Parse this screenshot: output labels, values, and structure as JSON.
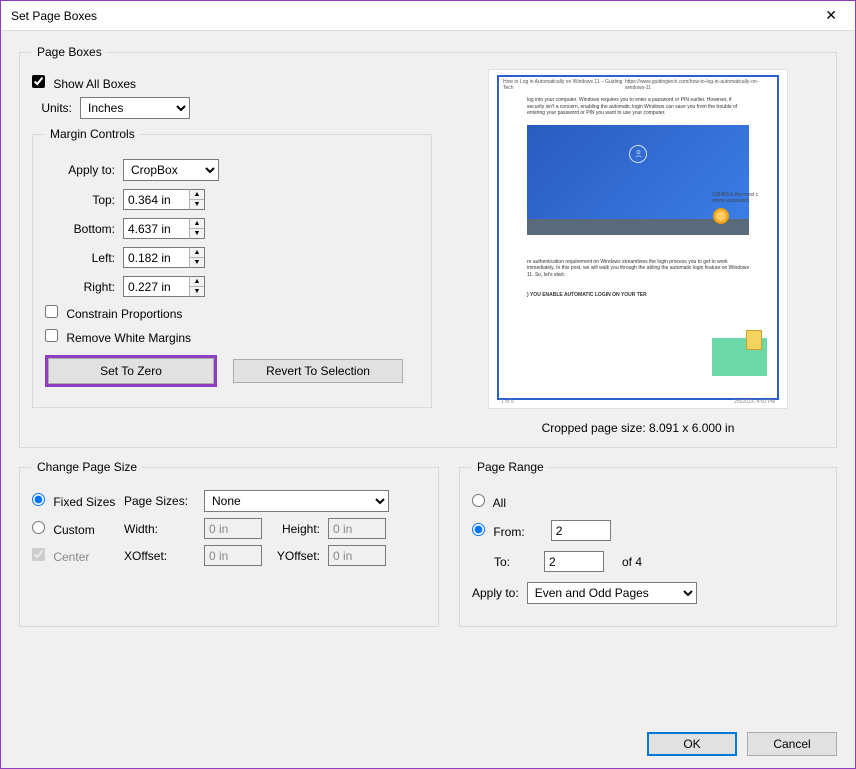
{
  "window": {
    "title": "Set Page Boxes"
  },
  "pageBoxes": {
    "legend": "Page Boxes",
    "showAll": {
      "label": "Show All Boxes",
      "checked": true
    },
    "units": {
      "label": "Units:",
      "value": "Inches"
    },
    "margin": {
      "legend": "Margin Controls",
      "applyTo": {
        "label": "Apply to:",
        "value": "CropBox"
      },
      "top": {
        "label": "Top:",
        "value": "0.364 in"
      },
      "bottom": {
        "label": "Bottom:",
        "value": "4.637 in"
      },
      "left": {
        "label": "Left:",
        "value": "0.182 in"
      },
      "right": {
        "label": "Right:",
        "value": "0.227 in"
      },
      "constrain": {
        "label": "Constrain Proportions",
        "checked": false
      },
      "removeWhite": {
        "label": "Remove White Margins",
        "checked": false
      },
      "setZero": "Set To Zero",
      "revert": "Revert To Selection"
    },
    "preview": {
      "caption": "Cropped page size: 8.091 x 6.000 in",
      "header_left": "How to Log in Automatically on Windows 11 – Guiding Tech",
      "header_right": "https://www.guidingtech.com/how-to-log-in-automatically-on-windows-11",
      "para1": "log into your computer. Windows requires you to enter a password or PIN earlier. However, if security isn't a concern, enabling the automatic login Windows can save you from the trouble of entering your password or PIN you want to use your computer.",
      "sidebar": "123456 is the most c ommo password.",
      "para2": "re authentication requirement on Windows streamlines the login process you to get to work immediately. In this post, we will walk you through the abling the automatic login feature on Windows 11. So, let's start.",
      "heading": ") YOU ENABLE AUTOMATIC LOGIN ON YOUR TER",
      "footer_left": "1 of 5",
      "footer_right": "2/5/2023, 4:50 PM"
    }
  },
  "changeSize": {
    "legend": "Change Page Size",
    "fixed": {
      "label": "Fixed Sizes",
      "checked": true
    },
    "pageSizes": {
      "label": "Page Sizes:",
      "value": "None"
    },
    "custom": {
      "label": "Custom",
      "checked": false
    },
    "width": {
      "label": "Width:",
      "value": "0 in"
    },
    "height": {
      "label": "Height:",
      "value": "0 in"
    },
    "center": {
      "label": "Center",
      "checked": true
    },
    "xoffset": {
      "label": "XOffset:",
      "value": "0 in"
    },
    "yoffset": {
      "label": "YOffset:",
      "value": "0 in"
    }
  },
  "pageRange": {
    "legend": "Page Range",
    "all": {
      "label": "All",
      "checked": false
    },
    "from": {
      "label": "From:",
      "value": "2",
      "checked": true
    },
    "to": {
      "label": "To:",
      "value": "2",
      "total": "of 4"
    },
    "applyTo": {
      "label": "Apply to:",
      "value": "Even and Odd Pages"
    }
  },
  "actions": {
    "ok": "OK",
    "cancel": "Cancel"
  }
}
